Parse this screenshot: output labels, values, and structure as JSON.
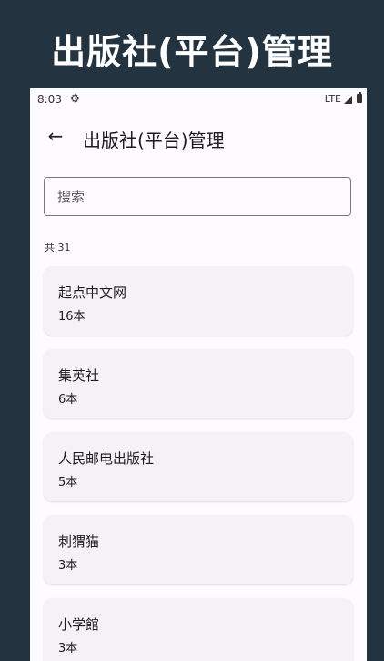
{
  "banner": {
    "title": "出版社(平台)管理"
  },
  "status_bar": {
    "time": "8:03",
    "network": "LTE"
  },
  "app_bar": {
    "title": "出版社(平台)管理",
    "back_icon": "arrow-left-icon"
  },
  "search": {
    "placeholder": "搜索",
    "value": ""
  },
  "count_label": "共 31",
  "publishers": [
    {
      "name": "起点中文网",
      "count": "16本"
    },
    {
      "name": "集英社",
      "count": "6本"
    },
    {
      "name": "人民邮电出版社",
      "count": "5本"
    },
    {
      "name": "刺猬猫",
      "count": "3本"
    },
    {
      "name": "小学館",
      "count": "3本"
    }
  ],
  "colors": {
    "banner_bg": "#243340",
    "page_bg": "#fdfbfd",
    "card_bg": "#f5f2f7"
  }
}
